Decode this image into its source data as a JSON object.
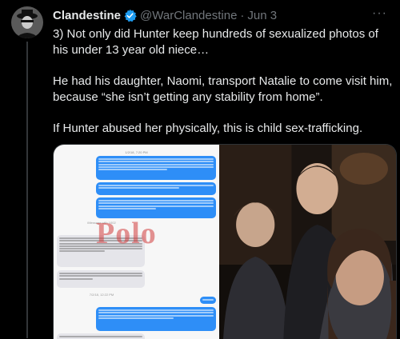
{
  "post": {
    "display_name": "Clandestine",
    "handle": "@WarClandestine",
    "separator": "·",
    "date": "Jun 3",
    "more_label": "···",
    "paragraphs": [
      "3) Not only did Hunter keep hundreds of sexualized photos of his under 13 year old niece…",
      "He had his daughter, Naomi, transport Natalie to come visit him, because “she isn’t getting any stability from home”.",
      "If Hunter abused her physically, this is child sex-trafficking."
    ]
  },
  "media": {
    "chat_timestamps": [
      "1/2/18, 7:20 PM",
      "iMessage with 1002",
      "7/2/18, 12:22 PM"
    ],
    "watermark": "Polo",
    "icons": {
      "avatar": "hooded-figure-avatar",
      "verified": "verified-badge-icon",
      "more": "more-options-icon"
    },
    "colors": {
      "verified": "#1d9bf0",
      "accent": "#2e8ef7"
    }
  }
}
